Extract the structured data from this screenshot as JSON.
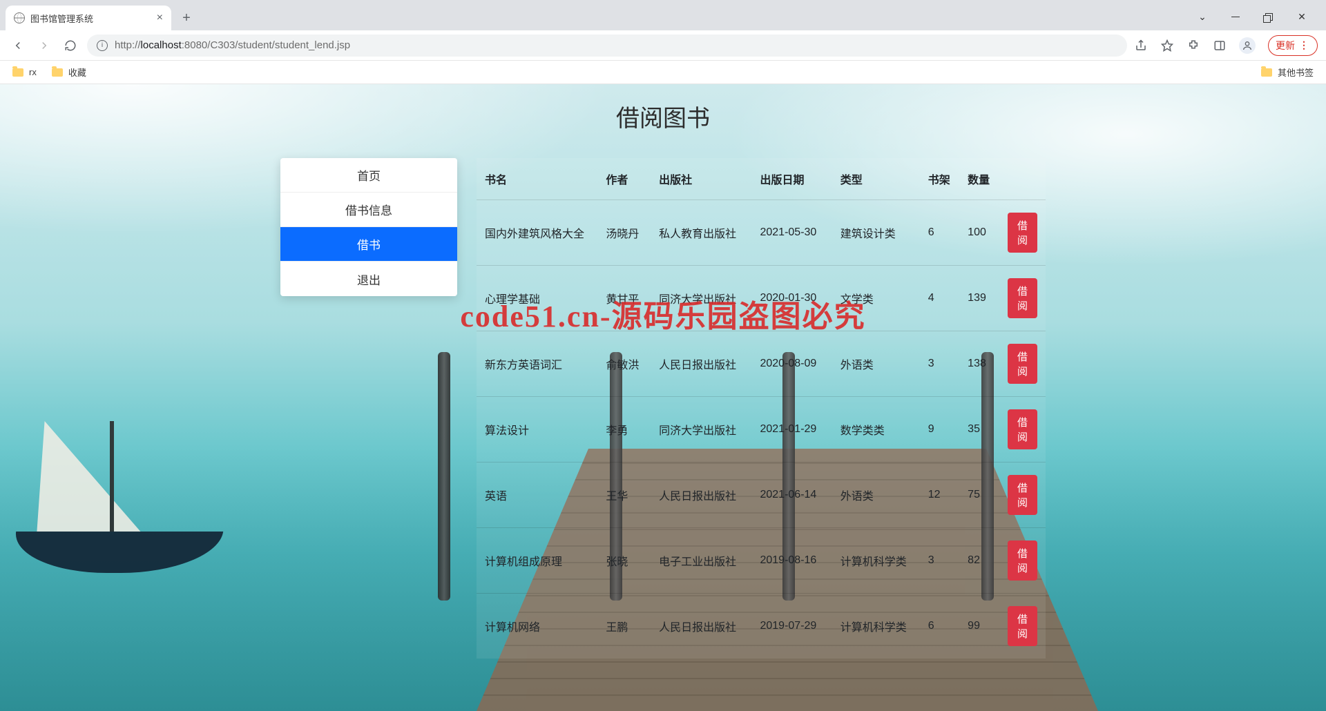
{
  "browser": {
    "tab_title": "图书馆管理系统",
    "url_host": "localhost",
    "url_port": ":8080",
    "url_path": "/C303/student/student_lend.jsp",
    "url_scheme_prefix": "http://",
    "update_label": "更新",
    "bookmarks": [
      "rx",
      "收藏"
    ],
    "other_bookmarks": "其他书签"
  },
  "page": {
    "title": "借阅图书",
    "watermark": "code51.cn-源码乐园盗图必究"
  },
  "menu": {
    "items": [
      {
        "label": "首页",
        "active": false
      },
      {
        "label": "借书信息",
        "active": false
      },
      {
        "label": "借书",
        "active": true
      },
      {
        "label": "退出",
        "active": false
      }
    ]
  },
  "table": {
    "headers": {
      "name": "书名",
      "author": "作者",
      "publisher": "出版社",
      "date": "出版日期",
      "type": "类型",
      "shelf": "书架",
      "qty": "数量"
    },
    "borrow_label": "借阅",
    "rows": [
      {
        "name": "国内外建筑风格大全",
        "author": "汤晓丹",
        "publisher": "私人教育出版社",
        "date": "2021-05-30",
        "type": "建筑设计类",
        "shelf": "6",
        "qty": "100"
      },
      {
        "name": "心理学基础",
        "author": "黄甘平",
        "publisher": "同济大学出版社",
        "date": "2020-01-30",
        "type": "文学类",
        "shelf": "4",
        "qty": "139"
      },
      {
        "name": "新东方英语词汇",
        "author": "俞敏洪",
        "publisher": "人民日报出版社",
        "date": "2020-08-09",
        "type": "外语类",
        "shelf": "3",
        "qty": "138"
      },
      {
        "name": "算法设计",
        "author": "李勇",
        "publisher": "同济大学出版社",
        "date": "2021-01-29",
        "type": "数学类类",
        "shelf": "9",
        "qty": "35"
      },
      {
        "name": "英语",
        "author": "王华",
        "publisher": "人民日报出版社",
        "date": "2021-06-14",
        "type": "外语类",
        "shelf": "12",
        "qty": "75"
      },
      {
        "name": "计算机组成原理",
        "author": "张晓",
        "publisher": "电子工业出版社",
        "date": "2019-08-16",
        "type": "计算机科学类",
        "shelf": "3",
        "qty": "82"
      },
      {
        "name": "计算机网络",
        "author": "王鹏",
        "publisher": "人民日报出版社",
        "date": "2019-07-29",
        "type": "计算机科学类",
        "shelf": "6",
        "qty": "99"
      }
    ]
  }
}
